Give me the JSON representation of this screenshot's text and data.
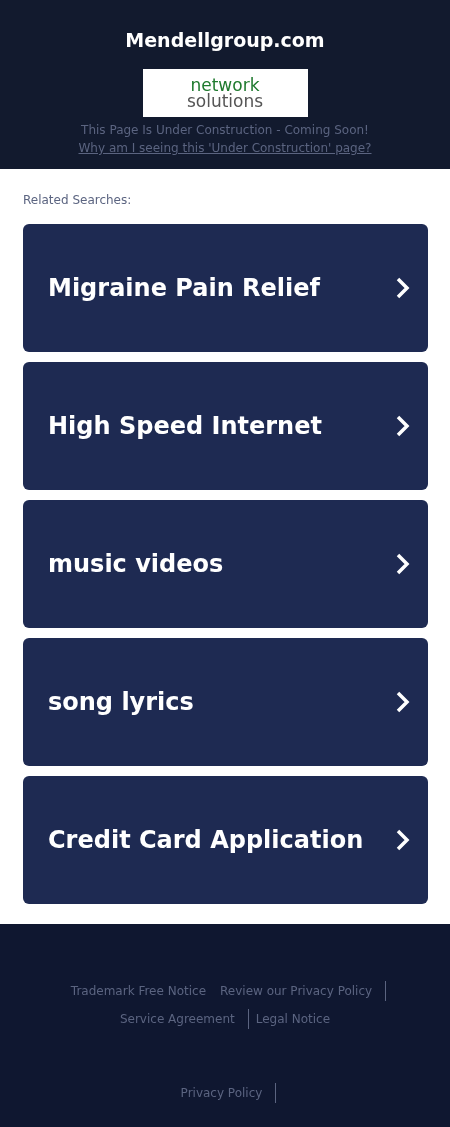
{
  "header": {
    "title": "Mendellgroup.com",
    "logo": {
      "line_1": "network",
      "line_2": "solutions"
    },
    "notice": "This Page Is Under Construction - Coming Soon!",
    "notice_link": "Why am I seeing this 'Under Construction' page?"
  },
  "related": {
    "heading": "Related Searches:",
    "items": [
      {
        "label": "Migraine Pain Relief"
      },
      {
        "label": "High Speed Internet"
      },
      {
        "label": "music videos"
      },
      {
        "label": "song lyrics"
      },
      {
        "label": "Credit Card Application"
      }
    ]
  },
  "footer": {
    "links": [
      {
        "label": "Trademark Free Notice",
        "divider": false
      },
      {
        "label": "Review our Privacy Policy",
        "divider": true
      },
      {
        "label": "Service Agreement",
        "divider": true
      },
      {
        "label": "Legal Notice",
        "divider": false
      }
    ],
    "bottom_links": [
      {
        "label": "Privacy Policy",
        "divider": true
      }
    ]
  }
}
